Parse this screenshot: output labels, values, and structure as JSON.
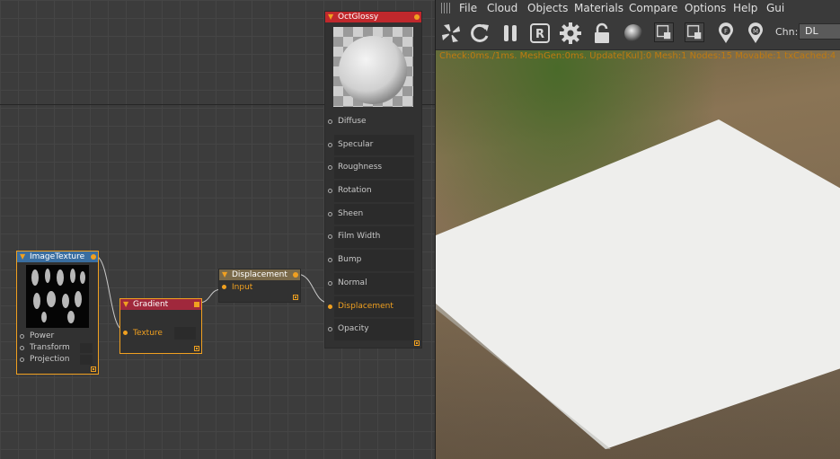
{
  "graph": {
    "nodes": {
      "image_texture": {
        "title": "ImageTexture",
        "ports": [
          "Power",
          "Transform",
          "Projection"
        ]
      },
      "gradient": {
        "title": "Gradient",
        "ports": [
          "Texture"
        ]
      },
      "displacement": {
        "title": "Displacement",
        "ports": [
          "Input"
        ]
      },
      "oct_glossy": {
        "title": "OctGlossy",
        "ports": [
          "Diffuse",
          "Specular",
          "Roughness",
          "Rotation",
          "Sheen",
          "Film Width",
          "Bump",
          "Normal",
          "Displacement",
          "Opacity"
        ]
      }
    }
  },
  "menubar": {
    "items": [
      "File",
      "Cloud",
      "Objects",
      "Materials",
      "Compare",
      "Options",
      "Help",
      "Gui"
    ]
  },
  "toolbar": {
    "icons": [
      "pinwheel-icon",
      "refresh-icon",
      "pause-icon",
      "r-icon",
      "gear-icon",
      "lock-icon",
      "sphere-icon",
      "region-icon",
      "region-icon",
      "focus-pin-icon",
      "material-pin-icon"
    ],
    "channel_label": "Chn:",
    "channel_value": "DL"
  },
  "status": {
    "text": "Check:0ms./1ms. MeshGen:0ms. Update[Kul]:0 Mesh:1 Nodes:15 Movable:1 txCached:4"
  },
  "colors": {
    "accent": "#f0a020",
    "image_texture_header": "#3a6ea0",
    "gradient_header": "#a0283c",
    "displacement_header": "#7a6a4a",
    "oct_glossy_header": "#c0282c",
    "status_text": "#c07a10"
  }
}
